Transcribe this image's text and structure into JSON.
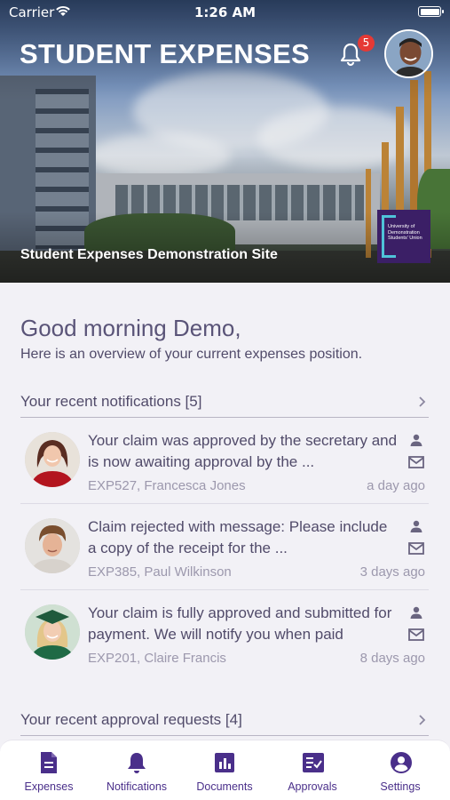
{
  "status_bar": {
    "carrier": "Carrier",
    "time": "1:26 AM"
  },
  "header": {
    "title": "STUDENT EXPENSES",
    "notification_count": "5",
    "site_name": "Student Expenses Demonstration Site",
    "logo_text": "University of Demonstration Students' Union"
  },
  "greeting": {
    "title": "Good morning Demo,",
    "subtitle": "Here is an overview of your current expenses position."
  },
  "notifications_section": {
    "title": "Your recent notifications [5]",
    "items": [
      {
        "message": "Your claim was approved by the secretary and is now awaiting approval by the ...",
        "ref": "EXP527, Francesca Jones",
        "time": "a day ago"
      },
      {
        "message": "Claim rejected with message: Please include a copy of the receipt for the ...",
        "ref": "EXP385, Paul Wilkinson",
        "time": "3 days ago"
      },
      {
        "message": "Your claim is fully approved and submitted for payment. We will notify you when paid",
        "ref": "EXP201, Claire Francis",
        "time": "8 days ago"
      }
    ]
  },
  "approvals_section": {
    "title": "Your recent approval requests [4]"
  },
  "tabbar": {
    "tabs": [
      {
        "label": "Expenses",
        "icon": "document-icon"
      },
      {
        "label": "Notifications",
        "icon": "bell-icon"
      },
      {
        "label": "Documents",
        "icon": "chart-doc-icon"
      },
      {
        "label": "Approvals",
        "icon": "checklist-icon"
      },
      {
        "label": "Settings",
        "icon": "user-circle-icon"
      }
    ]
  },
  "colors": {
    "accent": "#4a2f8a",
    "badge": "#e53935",
    "text": "#514b6a",
    "muted": "#9c98ad",
    "background": "#f2f1f6"
  }
}
